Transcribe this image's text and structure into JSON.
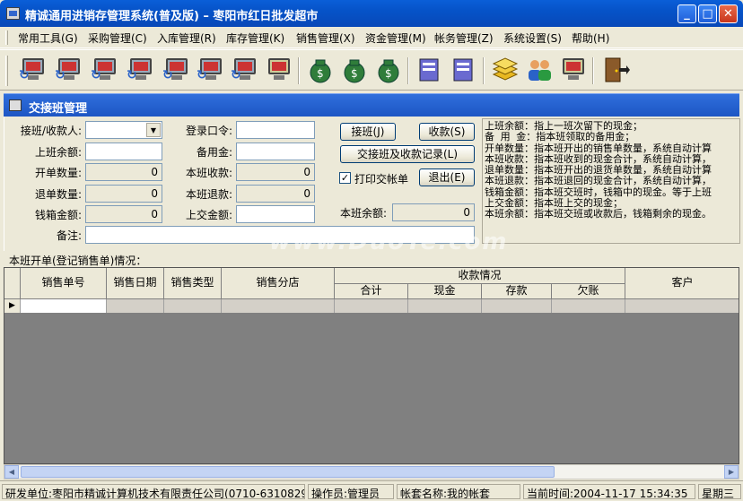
{
  "window": {
    "title": "精诚通用进销存管理系统(普及版) – 枣阳市红日批发超市"
  },
  "menu": [
    {
      "label": "常用工具(G)"
    },
    {
      "label": "采购管理(C)"
    },
    {
      "label": "入库管理(R)"
    },
    {
      "label": "库存管理(K)"
    },
    {
      "label": "销售管理(X)"
    },
    {
      "label": "资金管理(M)"
    },
    {
      "label": "帐务管理(Z)"
    },
    {
      "label": "系统设置(S)"
    },
    {
      "label": "帮助(H)"
    }
  ],
  "toolbar": {
    "icons": [
      "computer-icon",
      "computer-icon",
      "computer-icon",
      "computer-icon",
      "computer-icon",
      "computer-icon",
      "computer-icon",
      "computer-icon",
      "money-bag-icon",
      "money-bag-icon",
      "money-bag-icon",
      "document-icon",
      "document-icon",
      "books-icon",
      "users-icon",
      "computer-icon",
      "exit-door-icon"
    ]
  },
  "panel": {
    "title": "交接班管理"
  },
  "form": {
    "cashier_label": "接班/收款人:",
    "cashier_value": "",
    "password_label": "登录口令:",
    "password_value": "",
    "prev_balance_label": "上班余额:",
    "prev_balance_value": "",
    "reserve_label": "备用金:",
    "reserve_value": "",
    "open_count_label": "开单数量:",
    "open_count_value": "0",
    "shift_income_label": "本班收款:",
    "shift_income_value": "0",
    "return_count_label": "退单数量:",
    "return_count_value": "0",
    "shift_refund_label": "本班退款:",
    "shift_refund_value": "0",
    "cash_box_label": "钱箱金额:",
    "cash_box_value": "0",
    "handover_label": "上交金额:",
    "handover_value": "",
    "shift_balance_label": "本班余额:",
    "shift_balance_value": "0",
    "notes_label": "备注:",
    "notes_value": ""
  },
  "buttons": {
    "take_shift": "接班(J)",
    "collect": "收款(S)",
    "records": "交接班及收款记录(L)",
    "print_label": "打印交帐单",
    "print_checked": "✓",
    "exit": "退出(E)"
  },
  "info_lines": [
    "上班余额：指上一班次留下的现金；",
    "备 用 金：指本班领取的备用金；",
    "开单数量：指本班开出的销售单数量，系统自动计算",
    "本班收款：指本班收到的现金合计，系统自动计算，",
    "退单数量：指本班开出的退货单数量，系统自动计算",
    "本班退款：指本班退回的现金合计，系统自动计算，",
    "钱箱金额：指本班交班时，钱箱中的现金。等于上班",
    "上交金额：指本班上交的现金；",
    "本班余额：指本班交班或收款后，钱箱剩余的现金。"
  ],
  "section": {
    "label": "本班开单(登记销售单)情况："
  },
  "grid": {
    "columns": {
      "order_no": "销售单号",
      "date": "销售日期",
      "type": "销售类型",
      "store": "销售分店",
      "payment_group": "收款情况",
      "total": "合计",
      "cash": "现金",
      "deposit": "存款",
      "debt": "欠账",
      "customer": "客户"
    },
    "row_indicator": "▶"
  },
  "status": {
    "developer": "研发单位:枣阳市精诚计算机技术有限责任公司(0710-6310829)",
    "operator": "操作员:管理员",
    "account": "帐套名称:我的帐套",
    "time": "当前时间:2004-11-17  15:34:35",
    "weekday": "星期三"
  },
  "watermark": "www.DuoTe.com"
}
